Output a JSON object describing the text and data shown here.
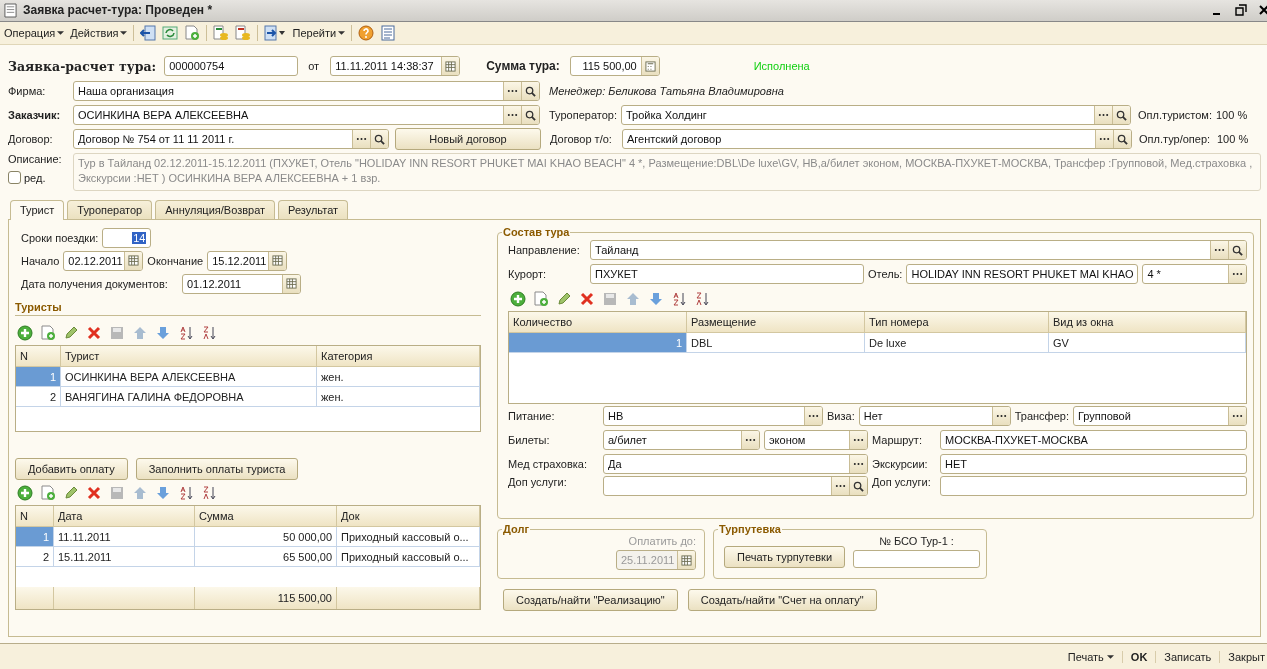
{
  "window": {
    "title": "Заявка  расчет-тура: Проведен *"
  },
  "toolbar": {
    "menus": [
      "Операция",
      "Действия"
    ],
    "goto": "Перейти"
  },
  "header": {
    "doc_label": "Заявка-расчет тура:",
    "number": "000000754",
    "date_label": "от",
    "date": "11.11.2011 14:38:37",
    "sum_label": "Сумма тура:",
    "sum": "115 500,00",
    "status": "Исполнена"
  },
  "firm": {
    "label": "Фирма:",
    "value": "Наша организация"
  },
  "manager": "Менеджер: Беликова Татьяна Владимировна",
  "customer": {
    "label": "Заказчик:",
    "value": "ОСИНКИНА ВЕРА АЛЕКСЕЕВНА"
  },
  "operator": {
    "label": "Туроператор:",
    "value": "Тройка Холдинг"
  },
  "paid_by_tourist": {
    "label": "Опл.туристом:",
    "value": "100 %"
  },
  "contract": {
    "label": "Договор:",
    "value": "Договор № 754 от 11 11 2011 г.",
    "button": "Новый договор"
  },
  "operator_contract": {
    "label": "Договор т/о:",
    "value": "Агентский договор"
  },
  "paid_to_operator": {
    "label": "Опл.тур/опер:",
    "value": "100 %"
  },
  "description": {
    "label": "Описание:",
    "text": "Тур в Тайланд 02.12.2011-15.12.2011 (ПХУКЕТ, Отель \"HOLIDAY INN RESORT PHUKET MAI KHAO BEACH\" 4 *, Размещение:DBL\\De luxe\\GV, HB,а/билет эконом, МОСКВА-ПХУКЕТ-МОСКВА, Трансфер :Групповой, Мед.страховка , Экскурсии :НЕТ ) ОСИНКИНА ВЕРА АЛЕКСЕЕВНА + 1 взр.",
    "edit_label": "ред.",
    "edit_checked": false
  },
  "tabs": [
    {
      "label": "Турист",
      "selected": true
    },
    {
      "label": "Туроператор",
      "selected": false
    },
    {
      "label": "Аннуляция/Возврат",
      "selected": false
    },
    {
      "label": "Результат",
      "selected": false
    }
  ],
  "trip": {
    "days_label": "Сроки поездки:",
    "days": "14",
    "days_highlighted": true,
    "start_label": "Начало",
    "start": "02.12.2011",
    "end_label": "Окончание",
    "end": "15.12.2011",
    "docs_label": "Дата получения документов:",
    "docs_date": "01.12.2011"
  },
  "tourists": {
    "title": "Туристы",
    "columns": [
      "N",
      "Турист",
      "Категория"
    ],
    "rows": [
      {
        "n": "1",
        "name": "ОСИНКИНА ВЕРА АЛЕКСЕЕВНА",
        "category": "жен.",
        "selected": true
      },
      {
        "n": "2",
        "name": "ВАНЯГИНА ГАЛИНА ФЕДОРОВНА",
        "category": "жен.",
        "selected": false
      }
    ]
  },
  "payment_buttons": [
    "Добавить оплату",
    "Заполнить оплаты туриста"
  ],
  "payments": {
    "columns": [
      "N",
      "Дата",
      "Сумма",
      "Док"
    ],
    "rows": [
      {
        "n": "1",
        "date": "11.11.2011",
        "sum": "50 000,00",
        "doc": "Приходный кассовый о...",
        "selected": true
      },
      {
        "n": "2",
        "date": "15.11.2011",
        "sum": "65 500,00",
        "doc": "Приходный кассовый о...",
        "selected": false
      }
    ],
    "total": "115 500,00"
  },
  "composition": {
    "title": "Состав тура",
    "direction": {
      "label": "Направление:",
      "value": "Тайланд"
    },
    "resort": {
      "label": "Курорт:",
      "value": "ПХУКЕТ"
    },
    "hotel": {
      "label": "Отель:",
      "value": "HOLIDAY INN RESORT PHUKET MAI KHAO",
      "stars": "4 *"
    },
    "rooms": {
      "columns": [
        "Количество",
        "Размещение",
        "Тип номера",
        "Вид из окна"
      ],
      "rows": [
        {
          "qty": "1",
          "placement": "DBL",
          "room_type": "De luxe",
          "view": "GV",
          "selected": true
        }
      ]
    },
    "meals": {
      "label": "Питание:",
      "value": "HB"
    },
    "visa": {
      "label": "Виза:",
      "value": "Нет"
    },
    "transfer": {
      "label": "Трансфер:",
      "value": "Групповой"
    },
    "tickets": {
      "label": "Билеты:",
      "value": "а/билет",
      "class": "эконом"
    },
    "route": {
      "label": "Маршрут:",
      "value": "МОСКВА-ПХУКЕТ-МОСКВА"
    },
    "insurance": {
      "label": "Мед страховка:",
      "value": "Да"
    },
    "excursions": {
      "label": "Экскурсии:",
      "value": "НЕТ"
    },
    "extra": {
      "label": "Доп услуги:"
    },
    "extra_note": {
      "label": "Доп услуги:"
    }
  },
  "debt": {
    "title": "Долг",
    "pay_until_label": "Оплатить до:",
    "pay_until": "25.11.2011",
    "disabled": true
  },
  "voucher": {
    "title": "Турпутевка",
    "print_button": "Печать турпутевки",
    "bso_label": "№ БСО Тур-1 :"
  },
  "doc_buttons": [
    "Создать/найти \"Реализацию\"",
    "Создать/найти \"Счет на оплату\""
  ],
  "footer": {
    "print": "Печать",
    "ok": "OK",
    "save": "Записать",
    "close": "Закрыт"
  }
}
